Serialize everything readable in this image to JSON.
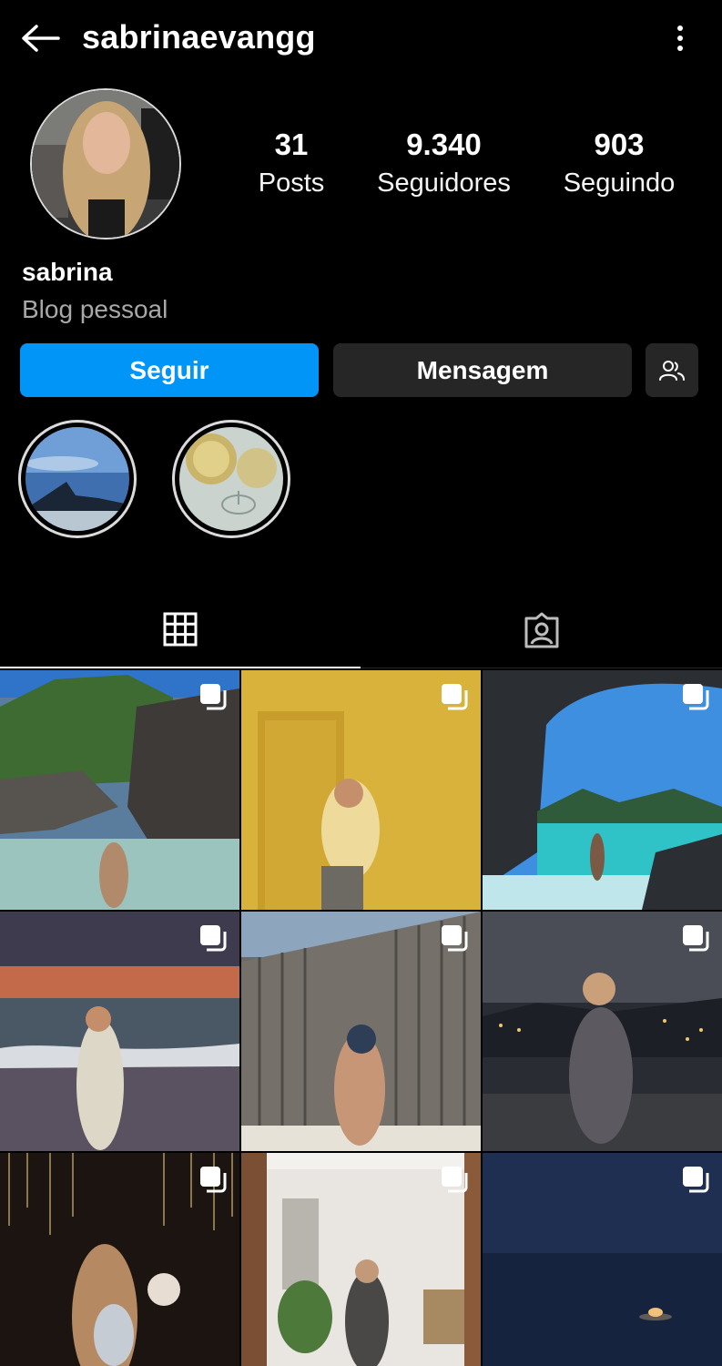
{
  "header": {
    "username": "sabrinaevangg",
    "back_icon": "arrow-left-icon",
    "more_icon": "more-vertical-icon"
  },
  "profile": {
    "stats": [
      {
        "value": "31",
        "label": "Posts"
      },
      {
        "value": "9.340",
        "label": "Seguidores"
      },
      {
        "value": "903",
        "label": "Seguindo"
      }
    ],
    "display_name": "sabrina",
    "category": "Blog pessoal"
  },
  "actions": {
    "follow_label": "Seguir",
    "message_label": "Mensagem",
    "suggest_icon": "add-person-icon"
  },
  "highlights": [
    "beach-mountain",
    "wine-glasses"
  ],
  "tabs": {
    "grid_icon": "grid-icon",
    "tagged_icon": "tagged-person-icon"
  },
  "colors": {
    "background": "#000000",
    "follow_button": "#0095f6",
    "secondary_button": "#262626",
    "muted_text": "#a8a8a8"
  },
  "posts": [
    {
      "scene": "beach-rocks-green",
      "multi": true
    },
    {
      "scene": "yellow-room-mirror",
      "multi": true
    },
    {
      "scene": "cave-blue-sea",
      "multi": true
    },
    {
      "scene": "sunset-beach",
      "multi": true
    },
    {
      "scene": "wooden-fence-beach",
      "multi": true
    },
    {
      "scene": "night-city-view",
      "multi": true
    },
    {
      "scene": "party-lights",
      "multi": true
    },
    {
      "scene": "white-room-mirror",
      "multi": true
    },
    {
      "scene": "night-sea-moon",
      "multi": true
    }
  ]
}
